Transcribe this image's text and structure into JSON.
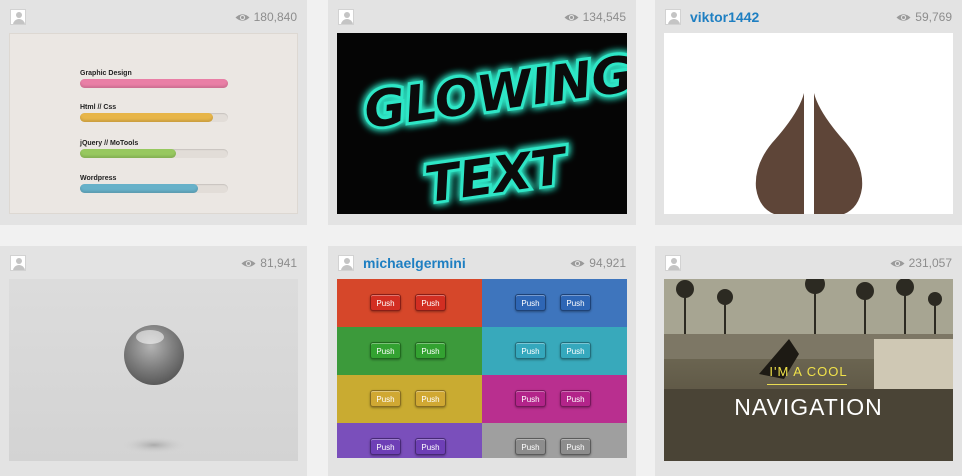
{
  "cards": [
    {
      "username": "",
      "views": "180,840",
      "skills": [
        {
          "label": "Graphic Design",
          "fill": 1.0,
          "color": "#e97fa6"
        },
        {
          "label": "Html // Css",
          "fill": 0.9,
          "color": "#e7b548"
        },
        {
          "label": "jQuery // MoTools",
          "fill": 0.65,
          "color": "#97c85f"
        },
        {
          "label": "Wordpress",
          "fill": 0.8,
          "color": "#67b1c9"
        }
      ]
    },
    {
      "username": "",
      "views": "134,545",
      "glow_text": "GLOWING TEXT",
      "glow_color": "#2ee6c6"
    },
    {
      "username": "viktor1442",
      "views": "59,769",
      "shape_color": "#5e4538"
    },
    {
      "username": "",
      "views": "81,941"
    },
    {
      "username": "michaelgermini",
      "views": "94,921",
      "button_label": "Push",
      "rows": [
        {
          "left": "#d6472a",
          "left_btn": "#d22e22",
          "right": "#3e75bd",
          "right_btn": "#2e66b5"
        },
        {
          "left": "#3c9a3b",
          "left_btn": "#33a231",
          "right": "#38a9bb",
          "right_btn": "#35a8bd"
        },
        {
          "left": "#c9ab31",
          "left_btn": "#d0a833",
          "right": "#b92f8f",
          "right_btn": "#b3248a"
        },
        {
          "left": "#7a4fbb",
          "left_btn": "#6e3fb6",
          "right": "#9f9f9f",
          "right_btn": "#8d8d8d"
        }
      ]
    },
    {
      "username": "",
      "views": "231,057",
      "nav_small": "I'M A COOL",
      "nav_big": "NAVIGATION"
    }
  ]
}
